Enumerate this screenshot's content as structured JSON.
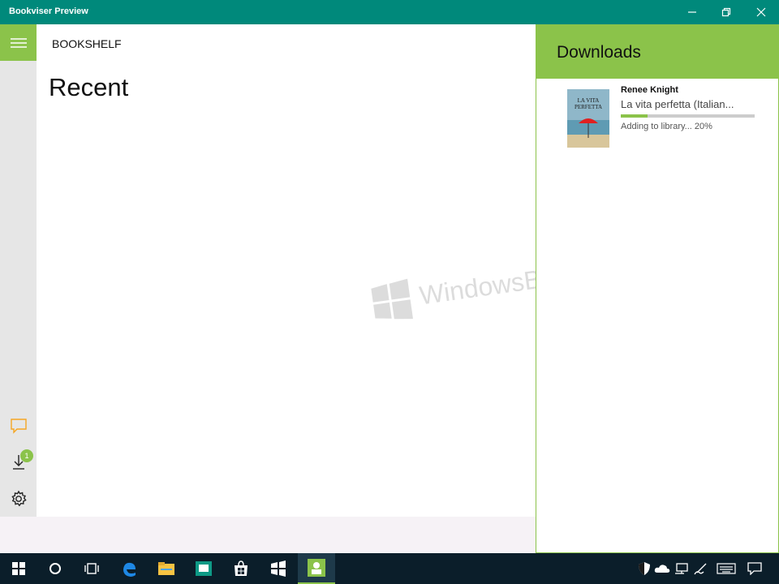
{
  "window": {
    "title": "Bookviser Preview",
    "controls": [
      "minimize-icon",
      "restore-icon",
      "close-icon"
    ]
  },
  "nav": {
    "menu_icon": "hamburger-icon",
    "section_label": "BOOKSHELF",
    "bottom_items": [
      {
        "icon": "feedback-icon"
      },
      {
        "icon": "download-icon",
        "badge": "1"
      },
      {
        "icon": "gear-icon"
      }
    ]
  },
  "main": {
    "heading": "Recent"
  },
  "watermark": {
    "text": "WindowsBlogItalia"
  },
  "downloads": {
    "title": "Downloads",
    "items": [
      {
        "author": "Renee Knight",
        "title": "La vita perfetta (Italian...",
        "cover_text": "LA VITA PERFETTA",
        "status": "Adding to library... 20%",
        "progress": 0.2
      }
    ]
  },
  "taskbar": {
    "apps": [
      "windows-start-icon",
      "cortana-icon",
      "task-view-icon",
      "edge-icon",
      "file-explorer-icon",
      "app-icon",
      "store-icon",
      "windows-app-icon",
      "bookviser-icon"
    ],
    "tray": [
      "defender-icon",
      "onedrive-icon",
      "network-icon",
      "pen-icon",
      "keyboard-icon",
      "action-center-icon"
    ]
  },
  "colors": {
    "accent": "#8bc34a",
    "titlebar": "#00897b",
    "taskbar": "#0b1e2a"
  }
}
